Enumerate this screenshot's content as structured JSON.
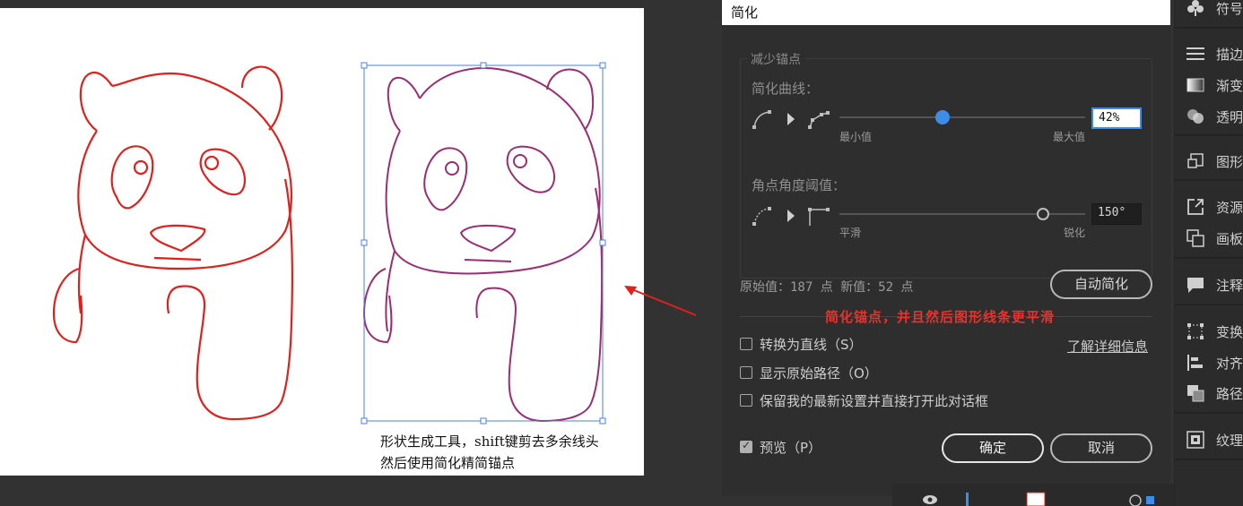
{
  "caption": {
    "line1": "形状生成工具，shift键剪去多余线头",
    "line2": "然后使用简化精简锚点"
  },
  "dialog": {
    "title": "简化",
    "group_title": "减少锚点",
    "curve_section": {
      "label": "简化曲线：",
      "min_label": "最小值",
      "max_label": "最大值",
      "value": "42%",
      "level_fraction": 0.42
    },
    "corner_section": {
      "label": "角点角度阈值：",
      "min_label": "平滑",
      "max_label": "锐化",
      "value": "150°",
      "level_fraction": 0.83
    },
    "stats": "原始值：187 点 新值：52 点",
    "auto_button": "自动简化",
    "annotation": "简化锚点，并且然后图形线条更平滑",
    "options": [
      {
        "label": "转换为直线（S）",
        "checked": false
      },
      {
        "label": "显示原始路径（O）",
        "checked": false
      },
      {
        "label": "保留我的最新设置并直接打开此对话框",
        "checked": false
      }
    ],
    "learn_more": "了解详细信息",
    "preview": {
      "label": "预览（P）",
      "checked": true
    },
    "ok_button": "确定",
    "cancel_button": "取消"
  },
  "right_panel": {
    "items": [
      {
        "label": "符号",
        "icon": "club-icon"
      },
      {
        "label": "描边",
        "icon": "stroke-icon"
      },
      {
        "label": "渐变",
        "icon": "gradient-icon"
      },
      {
        "label": "透明",
        "icon": "transparency-icon"
      },
      {
        "label": "图形",
        "icon": "graphic-style-icon"
      },
      {
        "label": "资源",
        "icon": "asset-export-icon"
      },
      {
        "label": "画板",
        "icon": "artboard-icon"
      },
      {
        "label": "注释",
        "icon": "comment-icon"
      },
      {
        "label": "变换",
        "icon": "transform-icon"
      },
      {
        "label": "对齐",
        "icon": "align-icon"
      },
      {
        "label": "路径",
        "icon": "pathfinder-icon"
      },
      {
        "label": "纹理",
        "icon": "texture-icon"
      }
    ]
  },
  "colors": {
    "accent": "#3d8de6",
    "panda_stroke": "#e0201c",
    "selection": "#4a7fe6",
    "annotation": "#e8312b"
  }
}
